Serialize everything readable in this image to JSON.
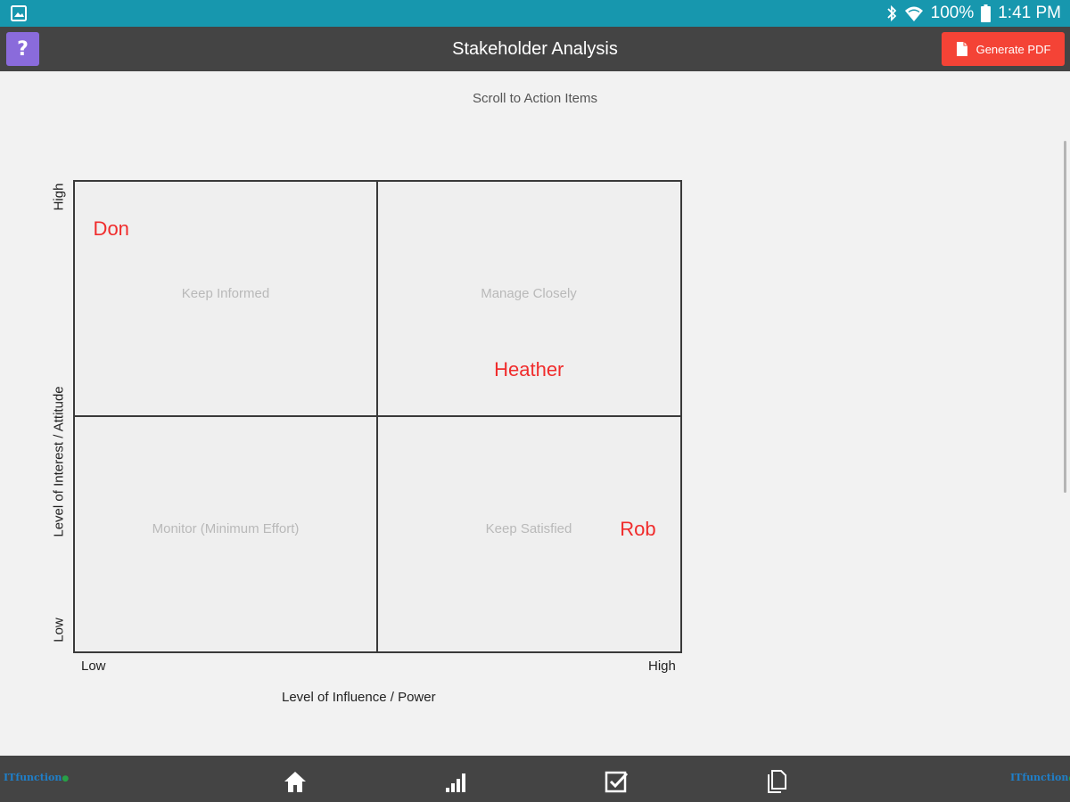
{
  "status_bar": {
    "battery": "100%",
    "time": "1:41 PM"
  },
  "app_bar": {
    "help_label": "?",
    "title": "Stakeholder Analysis",
    "pdf_label": "Generate PDF"
  },
  "content": {
    "scroll_link": "Scroll to Action Items",
    "matrix": {
      "quadrants": {
        "top_left": "Keep Informed",
        "top_right": "Manage Closely",
        "bottom_left": "Monitor (Minimum Effort)",
        "bottom_right": "Keep Satisfied"
      },
      "stakeholders": [
        {
          "name": "Don",
          "influence": 0.06,
          "interest": 0.9
        },
        {
          "name": "Heather",
          "influence": 0.75,
          "interest": 0.6
        },
        {
          "name": "Rob",
          "influence": 0.93,
          "interest": 0.26
        }
      ],
      "x_axis": {
        "label": "Level of Influence / Power",
        "low": "Low",
        "high": "High"
      },
      "y_axis": {
        "label": "Level of Interest / Attitude",
        "low": "Low",
        "high": "High"
      }
    }
  },
  "bottom_nav": {
    "brand": "ITfunction",
    "items": [
      "home-icon",
      "signal-bars-icon",
      "checkbox-icon",
      "document-icon"
    ]
  },
  "colors": {
    "status_bar": "#1797ae",
    "app_bar": "#444444",
    "help": "#8a6bdb",
    "pdf_button": "#f44336",
    "stakeholder": "#f02c2c"
  }
}
